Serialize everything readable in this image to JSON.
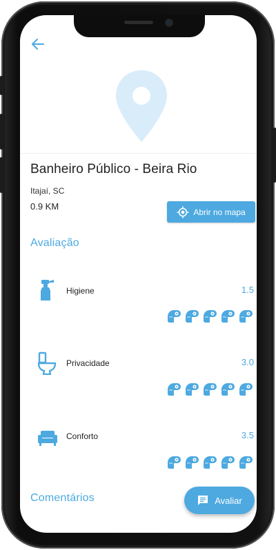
{
  "place": {
    "title": "Banheiro Público - Beira Rio",
    "city": "Itajaí, SC",
    "distance": "0.9 KM"
  },
  "actions": {
    "open_map_label": "Abrir no mapa",
    "rate_label": "Avaliar"
  },
  "sections": {
    "rating_title": "Avaliação",
    "comments_title": "Comentários"
  },
  "ratings": [
    {
      "label": "Higiene",
      "score": "1.5",
      "value": 1.5,
      "icon": "spray-bottle-icon"
    },
    {
      "label": "Privacidade",
      "score": "3.0",
      "value": 3.0,
      "icon": "toilet-icon"
    },
    {
      "label": "Conforto",
      "score": "3.5",
      "value": 3.5,
      "icon": "sofa-icon"
    }
  ],
  "colors": {
    "accent": "#4da9e0",
    "pin": "#d9ecfa"
  }
}
